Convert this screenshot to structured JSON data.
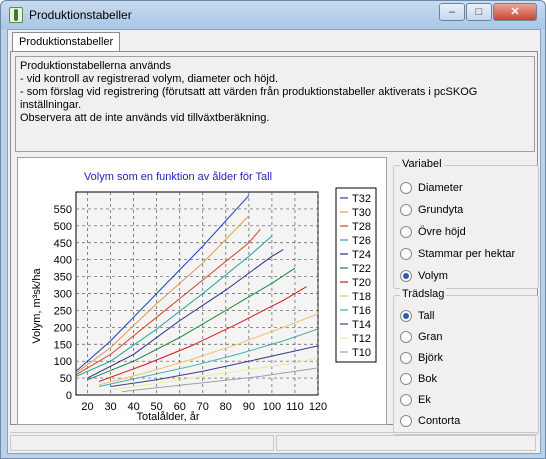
{
  "window": {
    "title": "Produktionstabeller",
    "minimize": "–",
    "maximize": "□",
    "close": "✕",
    "icon": "app-tree-icon"
  },
  "tab": {
    "label": "Produktionstabeller"
  },
  "info": {
    "lines": [
      "Produktionstabellerna används",
      "- vid kontroll av registrerad volym, diameter och höjd.",
      "- som förslag vid registrering (förutsatt att värden från produktionstabeller aktiverats i pcSKOG",
      "inställningar.",
      "Observera att de inte används vid tillväxtberäkning."
    ]
  },
  "variabel": {
    "label": "Variabel",
    "options": [
      "Diameter",
      "Grundyta",
      "Övre höjd",
      "Stammar per hektar",
      "Volym"
    ],
    "selected": 4
  },
  "tradslag": {
    "label": "Trädslag",
    "options": [
      "Tall",
      "Gran",
      "Björk",
      "Bok",
      "Ek",
      "Contorta"
    ],
    "selected": 0
  },
  "chart_data": {
    "type": "line",
    "title": "Volym som en funktion av ålder för Tall",
    "xlabel": "Totalålder, år",
    "ylabel": "Volym, m³sk/ha",
    "xlim": [
      15,
      120
    ],
    "ylim": [
      0,
      600
    ],
    "xticks": [
      20,
      30,
      40,
      50,
      60,
      70,
      80,
      90,
      100,
      110,
      120
    ],
    "yticks": [
      0,
      50,
      100,
      150,
      200,
      250,
      300,
      350,
      400,
      450,
      500,
      550
    ],
    "grid": true,
    "legend": "right",
    "series": [
      {
        "name": "T32",
        "color": "#1f3fbf",
        "points": [
          [
            15,
            70
          ],
          [
            30,
            160
          ],
          [
            50,
            300
          ],
          [
            70,
            440
          ],
          [
            90,
            590
          ]
        ]
      },
      {
        "name": "T30",
        "color": "#e09850",
        "points": [
          [
            15,
            65
          ],
          [
            30,
            140
          ],
          [
            50,
            270
          ],
          [
            70,
            390
          ],
          [
            90,
            530
          ]
        ]
      },
      {
        "name": "T28",
        "color": "#d84020",
        "points": [
          [
            15,
            60
          ],
          [
            30,
            120
          ],
          [
            50,
            230
          ],
          [
            70,
            340
          ],
          [
            90,
            450
          ],
          [
            95,
            490
          ]
        ]
      },
      {
        "name": "T26",
        "color": "#20a098",
        "points": [
          [
            15,
            55
          ],
          [
            30,
            100
          ],
          [
            50,
            195
          ],
          [
            70,
            300
          ],
          [
            90,
            410
          ],
          [
            100,
            470
          ]
        ]
      },
      {
        "name": "T24",
        "color": "#2a2a90",
        "points": [
          [
            20,
            50
          ],
          [
            40,
            120
          ],
          [
            60,
            220
          ],
          [
            80,
            310
          ],
          [
            100,
            410
          ],
          [
            105,
            430
          ]
        ]
      },
      {
        "name": "T22",
        "color": "#1e8a3a",
        "points": [
          [
            20,
            45
          ],
          [
            40,
            100
          ],
          [
            60,
            170
          ],
          [
            80,
            250
          ],
          [
            100,
            330
          ],
          [
            110,
            375
          ]
        ]
      },
      {
        "name": "T20",
        "color": "#d21818",
        "points": [
          [
            25,
            40
          ],
          [
            45,
            90
          ],
          [
            65,
            145
          ],
          [
            85,
            210
          ],
          [
            105,
            280
          ],
          [
            115,
            320
          ]
        ]
      },
      {
        "name": "T18",
        "color": "#f0c060",
        "points": [
          [
            25,
            30
          ],
          [
            45,
            65
          ],
          [
            65,
            105
          ],
          [
            85,
            150
          ],
          [
            105,
            200
          ],
          [
            120,
            240
          ]
        ]
      },
      {
        "name": "T16",
        "color": "#40b0a8",
        "points": [
          [
            25,
            25
          ],
          [
            45,
            55
          ],
          [
            65,
            85
          ],
          [
            85,
            120
          ],
          [
            105,
            160
          ],
          [
            120,
            195
          ]
        ]
      },
      {
        "name": "T14",
        "color": "#3c3c90",
        "points": [
          [
            30,
            25
          ],
          [
            50,
            45
          ],
          [
            70,
            70
          ],
          [
            90,
            100
          ],
          [
            110,
            130
          ],
          [
            120,
            145
          ]
        ]
      },
      {
        "name": "T12",
        "color": "#f0e8a0",
        "points": [
          [
            30,
            15
          ],
          [
            50,
            35
          ],
          [
            70,
            55
          ],
          [
            90,
            75
          ],
          [
            110,
            95
          ],
          [
            120,
            110
          ]
        ]
      },
      {
        "name": "T10",
        "color": "#a0a0a0",
        "points": [
          [
            35,
            10
          ],
          [
            55,
            25
          ],
          [
            75,
            40
          ],
          [
            95,
            55
          ],
          [
            115,
            75
          ],
          [
            120,
            80
          ]
        ]
      }
    ]
  }
}
